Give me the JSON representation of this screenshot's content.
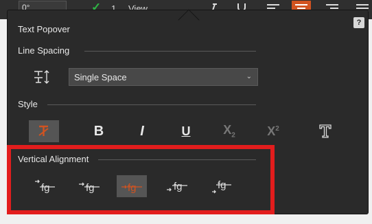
{
  "toolbar": {
    "angle_value": "0°",
    "count": "1",
    "view_label": "View"
  },
  "popover": {
    "title": "Text Popover",
    "help_label": "?",
    "line_spacing": {
      "label": "Line Spacing",
      "selected": "Single Space",
      "icon": "line-spacing-icon"
    },
    "style": {
      "label": "Style",
      "buttons": [
        {
          "name": "clear-format",
          "glyph": "",
          "state": "selected"
        },
        {
          "name": "bold",
          "glyph": "B",
          "state": "normal"
        },
        {
          "name": "italic",
          "glyph": "I",
          "state": "normal"
        },
        {
          "name": "underline",
          "glyph": "U",
          "state": "normal"
        },
        {
          "name": "subscript",
          "glyph": "X",
          "state": "disabled"
        },
        {
          "name": "superscript",
          "glyph": "X",
          "state": "disabled"
        },
        {
          "name": "outline-text",
          "glyph": "T",
          "state": "normal"
        }
      ]
    },
    "vertical_alignment": {
      "label": "Vertical Alignment",
      "selected_index": 2,
      "options": [
        "top",
        "upper-middle",
        "middle",
        "lower-middle",
        "bottom"
      ]
    }
  },
  "colors": {
    "accent": "#d25320",
    "highlight_box": "#e21d1d",
    "popover_bg": "#2a2a2a"
  }
}
